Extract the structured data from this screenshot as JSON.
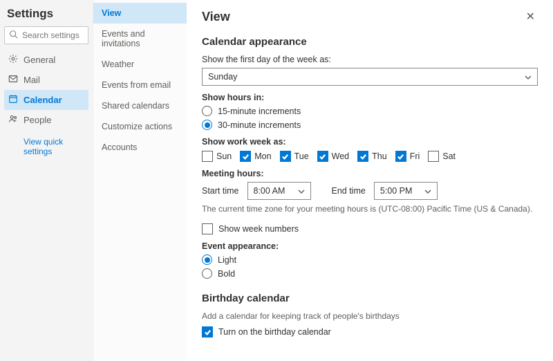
{
  "sidebar": {
    "title": "Settings",
    "search_placeholder": "Search settings",
    "items": [
      {
        "label": "General"
      },
      {
        "label": "Mail"
      },
      {
        "label": "Calendar"
      },
      {
        "label": "People"
      }
    ],
    "quick_link": "View quick settings"
  },
  "subnav": {
    "items": [
      {
        "label": "View"
      },
      {
        "label": "Events and invitations"
      },
      {
        "label": "Weather"
      },
      {
        "label": "Events from email"
      },
      {
        "label": "Shared calendars"
      },
      {
        "label": "Customize actions"
      },
      {
        "label": "Accounts"
      }
    ]
  },
  "main": {
    "title": "View",
    "sections": {
      "appearance": {
        "heading": "Calendar appearance",
        "first_day_label": "Show the first day of the week as:",
        "first_day_value": "Sunday",
        "show_hours_label": "Show hours in:",
        "increments_15": "15-minute increments",
        "increments_30": "30-minute increments",
        "work_week_label": "Show work week as:",
        "days": {
          "sun": "Sun",
          "mon": "Mon",
          "tue": "Tue",
          "wed": "Wed",
          "thu": "Thu",
          "fri": "Fri",
          "sat": "Sat"
        },
        "meeting_hours_label": "Meeting hours:",
        "start_label": "Start time",
        "start_value": "8:00 AM",
        "end_label": "End time",
        "end_value": "5:00 PM",
        "tz_note": "The current time zone for your meeting hours is (UTC-08:00) Pacific Time (US & Canada).",
        "show_week_numbers": "Show week numbers",
        "event_appearance_label": "Event appearance:",
        "light": "Light",
        "bold": "Bold"
      },
      "birthday": {
        "heading": "Birthday calendar",
        "subtext": "Add a calendar for keeping track of people's birthdays",
        "toggle_label": "Turn on the birthday calendar"
      }
    }
  }
}
